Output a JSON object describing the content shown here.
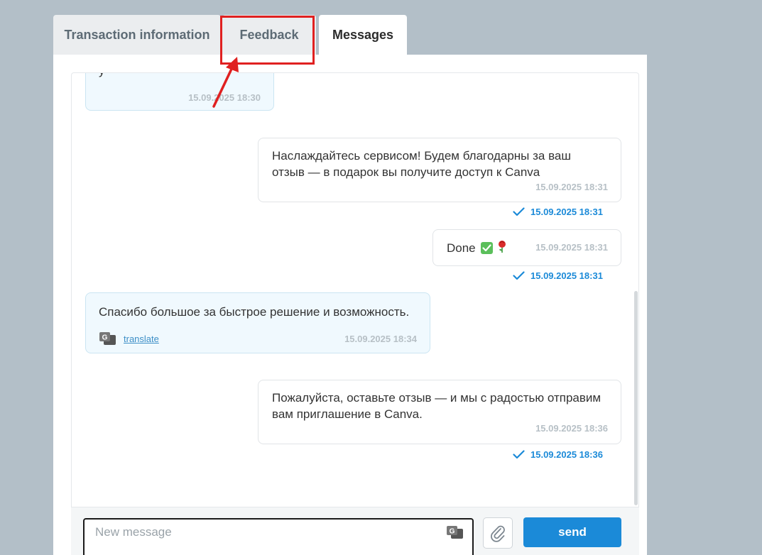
{
  "tabs": [
    {
      "label": "Transaction information"
    },
    {
      "label": "Feedback"
    },
    {
      "label": "Messages"
    }
  ],
  "messages": [
    {
      "direction": "incoming",
      "text": "у",
      "timestamp": "15.09.2025 18:30"
    },
    {
      "direction": "outgoing",
      "text": "Наслаждайтесь сервисом! Будем благодарны за ваш отзыв — в подарок вы получите доступ к Canva",
      "timestamp": "15.09.2025 18:31",
      "read_time": "15.09.2025 18:31"
    },
    {
      "direction": "outgoing",
      "text": "Done",
      "timestamp": "15.09.2025 18:31",
      "read_time": "15.09.2025 18:31"
    },
    {
      "direction": "incoming",
      "text": "Спасибо большое за быстрое решение и возможность.",
      "translate_label": "translate",
      "timestamp": "15.09.2025 18:34"
    },
    {
      "direction": "outgoing",
      "text": "Пожалуйста, оставьте отзыв — и мы с радостью отправим вам приглашение в Canva.",
      "timestamp": "15.09.2025 18:36",
      "read_time": "15.09.2025 18:36"
    }
  ],
  "composer": {
    "placeholder": "New message",
    "send_label": "send"
  },
  "icons": {
    "read": "check-icon",
    "translate": "google-translate-icon",
    "attach": "paperclip-icon",
    "emoji": [
      "check-mark-button-emoji",
      "rose-emoji"
    ]
  },
  "colors": {
    "accent": "#1b8ad8",
    "incoming_bubble": "#f0f9fe",
    "annotation": "#e02020"
  }
}
